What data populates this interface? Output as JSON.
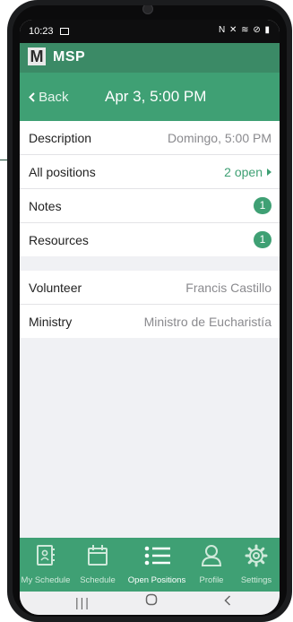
{
  "status_bar": {
    "time": "10:23",
    "right_icons": "N ✕ ≋ ⊘ ▮"
  },
  "app": {
    "logo_letter": "M",
    "name": "MSP"
  },
  "nav": {
    "back_label": "Back",
    "title": "Apr 3, 5:00 PM"
  },
  "details": [
    {
      "label": "Description",
      "value": "Domingo, 5:00 PM"
    },
    {
      "label": "All positions",
      "value": "2 open"
    },
    {
      "label": "Notes",
      "badge": "1"
    },
    {
      "label": "Resources",
      "badge": "1"
    }
  ],
  "assignment": [
    {
      "label": "Volunteer",
      "value": "Francis Castillo"
    },
    {
      "label": "Ministry",
      "value": "Ministro de Eucharistía"
    }
  ],
  "tabs": [
    {
      "label": "My Schedule",
      "icon": "contact-book-icon",
      "active": false
    },
    {
      "label": "Schedule",
      "icon": "calendar-icon",
      "active": false
    },
    {
      "label": "Open Positions",
      "icon": "list-icon",
      "active": true
    },
    {
      "label": "Profile",
      "icon": "person-icon",
      "active": false
    },
    {
      "label": "Settings",
      "icon": "gear-icon",
      "active": false
    }
  ],
  "colors": {
    "primary": "#3fa074",
    "appbar": "#3b8a66",
    "background": "#f0f1f4"
  }
}
